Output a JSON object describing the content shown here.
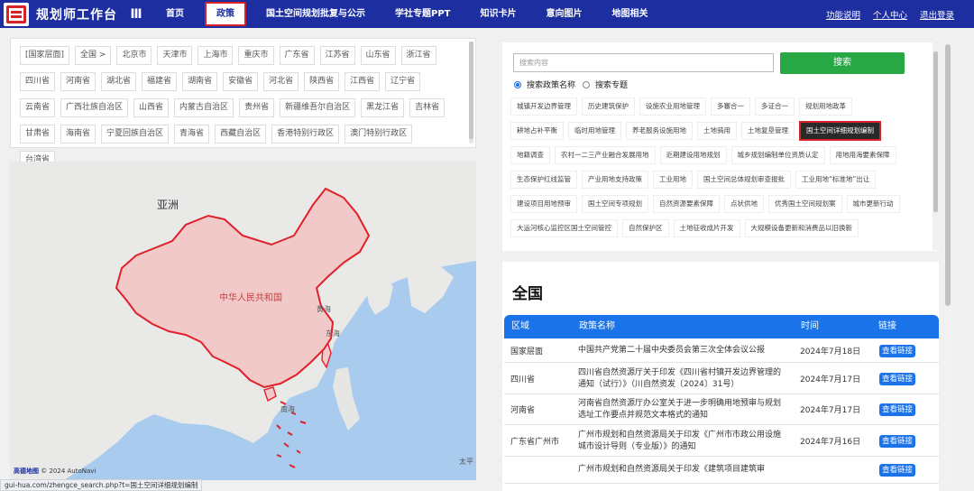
{
  "header": {
    "app_title": "规划师工作台",
    "menu_icon": "Ⅲ",
    "nav": [
      {
        "label": "首页"
      },
      {
        "label": "政策",
        "active": true
      },
      {
        "label": "国土空间规划批复与公示"
      },
      {
        "label": "学社专题PPT"
      },
      {
        "label": "知识卡片"
      },
      {
        "label": "意向图片"
      },
      {
        "label": "地图相关"
      }
    ],
    "right_links": [
      "功能说明",
      "个人中心",
      "退出登录"
    ],
    "colors": {
      "bar": "#1d2fa0",
      "highlight": "#d8222a"
    }
  },
  "regions": [
    "[国家层面]",
    "全国 >",
    "北京市",
    "天津市",
    "上海市",
    "重庆市",
    "广东省",
    "江苏省",
    "山东省",
    "浙江省",
    "四川省",
    "河南省",
    "湖北省",
    "福建省",
    "湖南省",
    "安徽省",
    "河北省",
    "陕西省",
    "江西省",
    "辽宁省",
    "云南省",
    "广西壮族自治区",
    "山西省",
    "内蒙古自治区",
    "贵州省",
    "新疆维吾尔自治区",
    "黑龙江省",
    "吉林省",
    "甘肃省",
    "海南省",
    "宁夏回族自治区",
    "青海省",
    "西藏自治区",
    "香港特别行政区",
    "澳门特别行政区",
    "台湾省"
  ],
  "map": {
    "labels": {
      "asia": "亚洲",
      "china": "中华人民共和国",
      "yellow_sea": "黄海",
      "east_sea": "东海",
      "south_sea": "南海",
      "pacific": "太平"
    },
    "copyright": "© 2024 AutoNavi",
    "brand": "高德地图"
  },
  "status_url": "gui-hua.com/zhengce_search.php?t=国土空间详细规划编制",
  "search": {
    "placeholder": "搜索内容",
    "button": "搜索",
    "radio_name": "搜索政策名称",
    "radio_topic": "搜索专题",
    "selected_radio": "搜索政策名称"
  },
  "tags": [
    "城镇开发边界管理",
    "历史建筑保护",
    "设施农业用地管理",
    "多審合一",
    "多证合一",
    "规划用地政革",
    "耕地占补平衡",
    "临时用地管理",
    "养老服务设施用地",
    "土地骑用",
    "土地复垦管理",
    "国土空间详细规划编制",
    "地籍调查",
    "农村一二三产业融合发展用地",
    "近期建设用地规划",
    "城乡规划编制单位资质认定",
    "用地用海要素保障",
    "生态保护红线监管",
    "产业用地支持政策",
    "工业用地",
    "国土空间总体规划审查报批",
    "工业用地“标准地”出让",
    "建设项目用地预审",
    "国土空间专项规划",
    "自然资源要素保障",
    "点状供地",
    "优秀国土空间规划案",
    "城市更新行动",
    "大运河核心监控区国土空间管控",
    "自然保护区",
    "土地征收成片开发",
    "大规模设备更新和消费品以旧换新"
  ],
  "selected_tag": "国土空间详细规划编制",
  "results": {
    "title": "全国",
    "headers": {
      "region": "区域",
      "policy": "政策名称",
      "time": "时间",
      "link": "链接"
    },
    "rows": [
      {
        "region": "国家层面",
        "policy": "中国共产党第二十届中央委员会第三次全体会议公报",
        "time": "2024年7月18日",
        "link": "查看链接"
      },
      {
        "region": "四川省",
        "policy": "四川省自然资源厅关于印发《四川省村镇开发边界管理的通知（试行）》（川自然资发〔2024〕31号）",
        "time": "2024年7月17日",
        "link": "查看链接"
      },
      {
        "region": "河南省",
        "policy": "河南省自然资源厅办公室关于进一步明确用地预审与规划选址工作要点并规范文本格式的通知",
        "time": "2024年7月17日",
        "link": "查看链接"
      },
      {
        "region": "广东省广州市",
        "policy": "广州市规划和自然资源局关于印发《广州市市政公用设施城市设计导则（专业版）》的通知",
        "time": "2024年7月16日",
        "link": "查看链接"
      },
      {
        "region": "",
        "policy": "广州市规划和自然资源局关于印发《建筑项目建筑审",
        "time": "",
        "link": "查看链接"
      }
    ]
  }
}
